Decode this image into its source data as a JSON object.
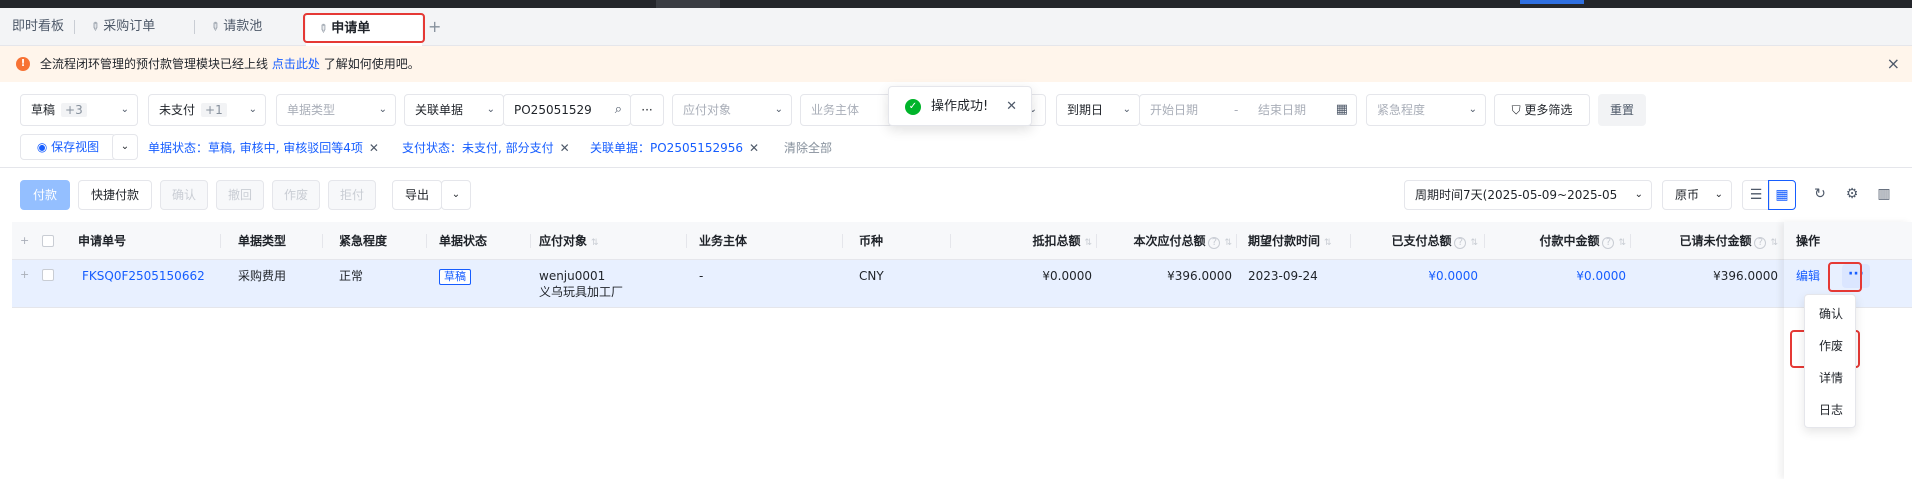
{
  "tabs": [
    {
      "label": "即时看板"
    },
    {
      "label": "采购订单"
    },
    {
      "label": "请款池"
    },
    {
      "label": "申请单"
    }
  ],
  "tab_add": "+",
  "notice": {
    "prefix": "全流程闭环管理的预付款管理模块已经上线",
    "link": "点击此处",
    "suffix": "了解如何使用吧。",
    "close": "×"
  },
  "filters": {
    "doc_status": {
      "value": "草稿",
      "extra": "+3"
    },
    "pay_status": {
      "value": "未支付",
      "extra": "+1"
    },
    "doc_type": {
      "placeholder": "单据类型"
    },
    "related": {
      "label": "关联单据",
      "value": "PO25051529"
    },
    "payee": {
      "placeholder": "应付对象"
    },
    "entity": {
      "placeholder": "业务主体"
    },
    "due": {
      "label": "到期日",
      "start": "开始日期",
      "sep": "-",
      "end": "结束日期"
    },
    "urgency": {
      "placeholder": "紧急程度"
    },
    "more": "更多筛选",
    "reset": "重置",
    "save_view": "保存视图",
    "chips": [
      {
        "text": "单据状态：草稿, 审核中, 审核驳回等4项"
      },
      {
        "text": "支付状态：未支付, 部分支付"
      },
      {
        "text": "关联单据：PO2505152956"
      }
    ],
    "clear_all": "清除全部"
  },
  "toast": {
    "text": "操作成功!"
  },
  "toolbar": {
    "pay": "付款",
    "quick_pay": "快捷付款",
    "confirm": "确认",
    "withdraw": "撤回",
    "void": "作废",
    "reject": "拒付",
    "export": "导出",
    "period": "周期时间7天(2025-05-09~2025-05",
    "currency": "原币"
  },
  "table": {
    "headers": {
      "id": "申请单号",
      "type": "单据类型",
      "urgency": "紧急程度",
      "status": "单据状态",
      "payee": "应付对象",
      "entity": "业务主体",
      "currency": "币种",
      "deduct": "抵扣总额",
      "payable": "本次应付总额",
      "expected": "期望付款时间",
      "paid": "已支付总额",
      "paying": "付款中金额",
      "unpaid": "已请未付金额",
      "ops": "操作"
    },
    "rows": [
      {
        "id": "FKSQ0F2505150662",
        "type": "采购费用",
        "urgency": "正常",
        "status": "草稿",
        "payee_code": "wenju0001",
        "payee_name": "义乌玩具加工厂",
        "entity": "-",
        "currency": "CNY",
        "deduct": "¥0.0000",
        "payable": "¥396.0000",
        "expected": "2023-09-24",
        "paid": "¥0.0000",
        "paying": "¥0.0000",
        "unpaid": "¥396.0000",
        "edit": "编辑",
        "more": "···"
      }
    ]
  },
  "dropdown": [
    "确认",
    "作废",
    "详情",
    "日志"
  ],
  "colors": {
    "accent": "#165dff",
    "highlight": "#e53935",
    "success": "#00b42a",
    "warning": "#f77234"
  }
}
